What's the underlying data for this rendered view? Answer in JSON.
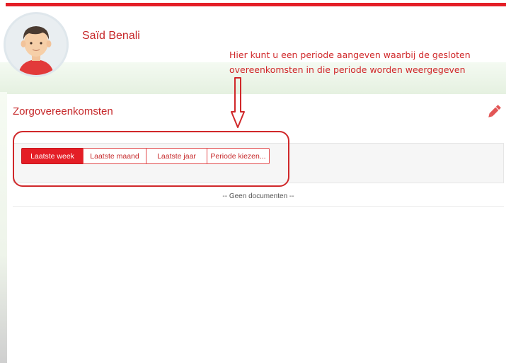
{
  "user": {
    "name": "Saïd Benali"
  },
  "annotation": {
    "text": "Hier kunt u een periode aangeven waarbij de gesloten overeenkomsten in die periode worden weergegeven"
  },
  "section": {
    "title": "Zorgovereenkomsten"
  },
  "filters": {
    "buttons": [
      {
        "label": "Laatste week",
        "active": true
      },
      {
        "label": "Laatste maand",
        "active": false
      },
      {
        "label": "Laatste jaar",
        "active": false
      },
      {
        "label": "Periode kiezen...",
        "active": false
      }
    ]
  },
  "documents": {
    "empty_message": "-- Geen documenten --"
  },
  "colors": {
    "accent": "#e41e26",
    "annotation": "#d0282a"
  },
  "icons": {
    "edit": "pencil-icon",
    "arrow": "down-arrow-icon",
    "avatar": "user-avatar"
  }
}
